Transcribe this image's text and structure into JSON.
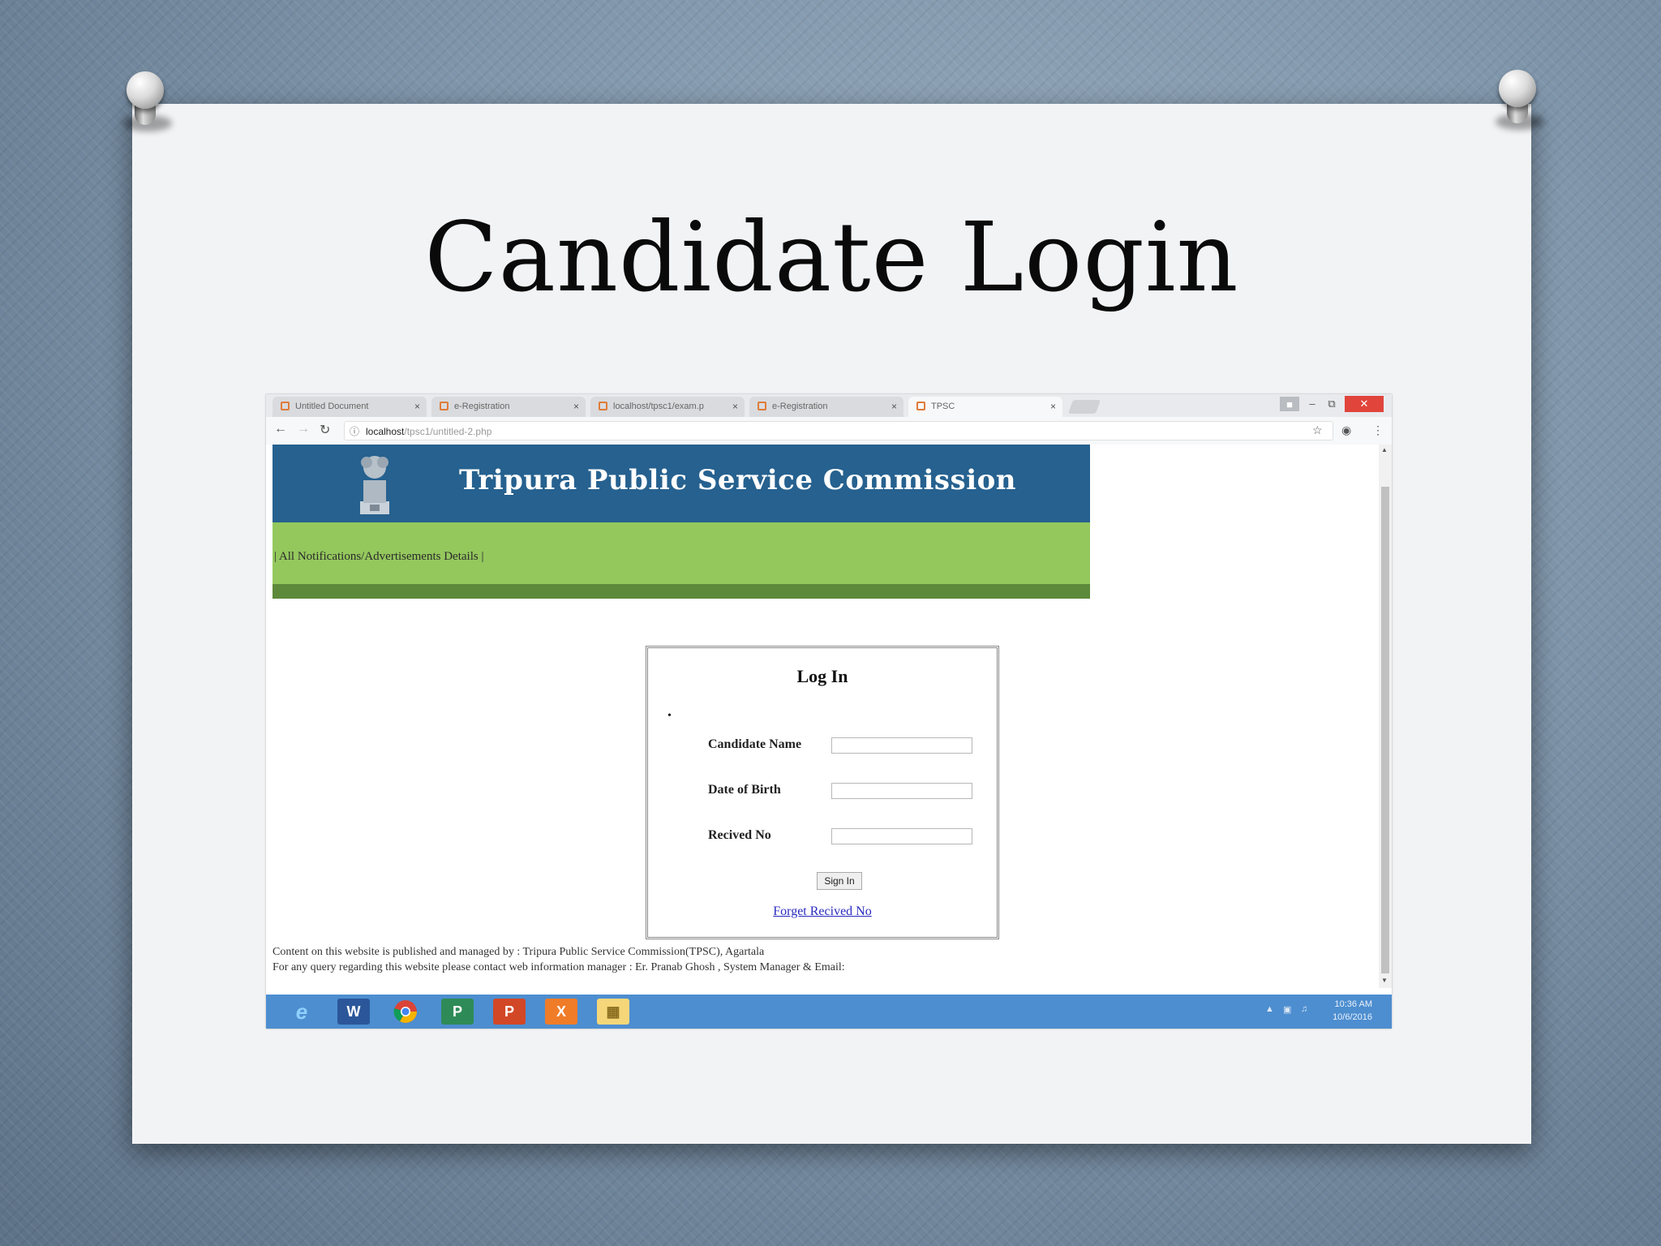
{
  "slide": {
    "title": "Candidate Login"
  },
  "browser": {
    "tabs": [
      {
        "label": "Untitled Document",
        "active": false
      },
      {
        "label": "e-Registration",
        "active": false
      },
      {
        "label": "localhost/tpsc1/exam.p",
        "active": false
      },
      {
        "label": "e-Registration",
        "active": false
      },
      {
        "label": "TPSC",
        "active": true
      }
    ],
    "tab_close_glyph": "×",
    "url_host": "localhost",
    "url_path": "/tpsc1/untitled-2.php"
  },
  "site": {
    "header_title": "Tripura Public Service Commission",
    "nav_text": "| All Notifications/Advertisements Details |"
  },
  "login": {
    "title": "Log In",
    "bullet": "•",
    "candidate_name_label": "Candidate Name",
    "dob_label": "Date of Birth",
    "received_no_label": "Recived No",
    "candidate_name_value": "",
    "dob_value": "",
    "received_no_value": "",
    "sign_in_label": "Sign In",
    "forget_link": "Forget Recived No"
  },
  "footer": {
    "line1": "Content on this website is published and managed by : Tripura Public Service Commission(TPSC), Agartala",
    "line2": "For any query regarding this website please contact web information manager : Er. Pranab Ghosh , System Manager & Email:"
  },
  "taskbar": {
    "word_label": "W",
    "publisher_label": "P",
    "powerpoint_label": "P",
    "xampp_label": "X",
    "time": "10:36 AM",
    "date": "10/6/2016"
  },
  "colors": {
    "header_blue": "#26618f",
    "nav_green": "#94c85d",
    "dark_green": "#5d8a3a",
    "taskbar_blue": "#4d8ed0",
    "close_red": "#e0443b"
  }
}
